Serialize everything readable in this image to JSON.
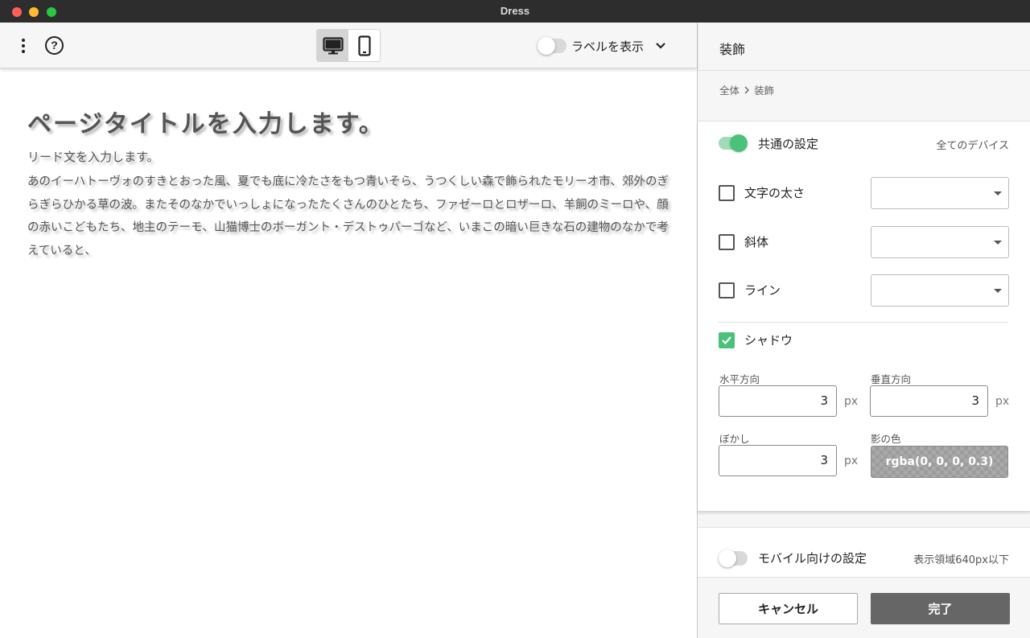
{
  "window": {
    "title": "Dress"
  },
  "toolbar": {
    "menu_icon": "kebab-menu-icon",
    "help_icon": "help-circle-icon",
    "help_glyph": "?",
    "device_buttons": [
      {
        "icon": "desktop-icon",
        "active": true
      },
      {
        "icon": "mobile-icon",
        "active": false
      }
    ],
    "show_labels": {
      "label": "ラベルを表示",
      "on": false
    },
    "expand_icon": "chevron-down-icon"
  },
  "preview": {
    "title": "ページタイトルを入力します。",
    "lead": "リード文を入力します。",
    "body": "あのイーハトーヴォのすきとおった風、夏でも底に冷たさをもつ青いそら、うつくしい森で飾られたモリーオ市、郊外のぎらぎらひかる草の波。またそのなかでいっしょになったたくさんのひとたち、ファゼーロとロザーロ、羊飼のミーロや、顔の赤いこどもたち、地主のテーモ、山猫博士のボーガント・デストゥパーゴなど、いまこの暗い巨きな石の建物のなかで考えていると、"
  },
  "panel": {
    "title": "装飾",
    "breadcrumb": [
      "全体",
      "装飾"
    ],
    "breadcrumb_sep_icon": "chevron-right-icon",
    "common": {
      "label": "共通の設定",
      "note": "全てのデバイス",
      "on": true
    },
    "options": [
      {
        "label": "文字の太さ",
        "checked": false,
        "value": ""
      },
      {
        "label": "斜体",
        "checked": false,
        "value": ""
      },
      {
        "label": "ライン",
        "checked": false,
        "value": ""
      }
    ],
    "shadow": {
      "label": "シャドウ",
      "checked": true,
      "horizontal": {
        "label": "水平方向",
        "value": "3",
        "unit": "px"
      },
      "vertical": {
        "label": "垂直方向",
        "value": "3",
        "unit": "px"
      },
      "blur": {
        "label": "ぼかし",
        "value": "3",
        "unit": "px"
      },
      "color": {
        "label": "影の色",
        "value": "rgba(0, 0, 0, 0.3)"
      }
    },
    "mobile": {
      "label": "モバイル向けの設定",
      "note": "表示領域640px以下",
      "on": false
    }
  },
  "footer": {
    "cancel_label": "キャンセル",
    "done_label": "完了"
  },
  "colors": {
    "accent_green": "#4ac27a",
    "primary_button": "#666666",
    "titlebar": "#2d2d2d"
  }
}
